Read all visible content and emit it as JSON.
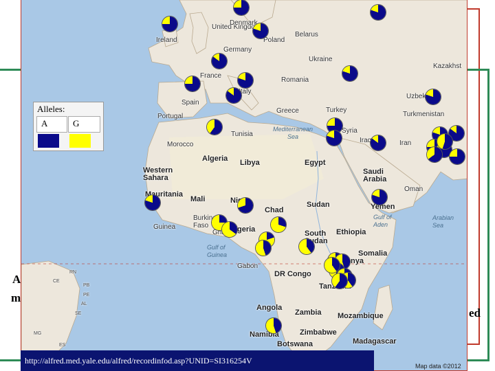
{
  "slide_fragments": {
    "left_line1": "A",
    "left_line2": "m",
    "right_word": "ed"
  },
  "legend": {
    "title": "Alleles:",
    "allele_a": "A",
    "allele_g": "G",
    "color_a": "#0a0a8a",
    "color_g": "#ffff00"
  },
  "url": "http://alfred.med.yale.edu/alfred/recordinfod.asp?UNID=SI316254V",
  "map_credit": "Map data ©2012",
  "countries": {
    "ireland": "Ireland",
    "united_kingdom": "United\nKingdom",
    "denmark": "Denmark",
    "germany": "Germany",
    "poland": "Poland",
    "belarus": "Belarus",
    "ukraine": "Ukraine",
    "kazakhstan": "Kazakhst",
    "france": "France",
    "romania": "Romania",
    "italy": "Italy",
    "uzbekistan": "Uzbekistan",
    "spain": "Spain",
    "portugal": "Portugal",
    "greece": "Greece",
    "turkey": "Turkey",
    "turkmenistan": "Turkmenistan",
    "syria": "Syria",
    "iraq": "Iraq",
    "iran": "Iran",
    "tunisia": "Tunisia",
    "morocco": "Morocco",
    "algeria": "Algeria",
    "libya": "Libya",
    "egypt": "Egypt",
    "saudi_arabia": "Saudi\nArabia",
    "oman": "Oman",
    "western_sahara": "Western\nSahara",
    "mauritania": "Mauritania",
    "mali": "Mali",
    "niger": "Niger",
    "chad": "Chad",
    "sudan": "Sudan",
    "yemen": "Yemen",
    "burkina_faso": "Burkina\nFaso",
    "ghana": "Ghana",
    "guinea": "Guinea",
    "nigeria": "Nigeria",
    "south_sudan": "South\nSudan",
    "ethiopia": "Ethiopia",
    "somalia": "Somalia",
    "gabon": "Gabon",
    "kenya": "Kenya",
    "dr_congo": "DR Congo",
    "tanzania": "Tanzania",
    "angola": "Angola",
    "zambia": "Zambia",
    "mozambique": "Mozambique",
    "namibia": "Namibia",
    "zimbabwe": "Zimbabwe",
    "botswana": "Botswana",
    "madagascar": "Madagascar"
  },
  "seas": {
    "mediterranean": "Mediterranean\nSea",
    "gulf_of_aden": "Gulf of\nAden",
    "arabian_sea": "Arabian\nSea",
    "gulf_of_guinea": "Gulf of\nGuinea"
  },
  "brazil_states": [
    "RN",
    "CE",
    "PB",
    "PE",
    "AL",
    "SE",
    "MG",
    "ES"
  ],
  "populations": [
    {
      "name": "pop-1",
      "a_fraction": 0.75
    },
    {
      "name": "pop-2",
      "a_fraction": 0.8
    },
    {
      "name": "pop-3",
      "a_fraction": 0.75
    },
    {
      "name": "pop-4",
      "a_fraction": 0.8
    },
    {
      "name": "pop-5",
      "a_fraction": 0.85
    },
    {
      "name": "pop-6",
      "a_fraction": 0.8
    },
    {
      "name": "pop-7",
      "a_fraction": 0.75
    },
    {
      "name": "pop-8",
      "a_fraction": 0.8
    },
    {
      "name": "pop-9",
      "a_fraction": 0.85
    },
    {
      "name": "pop-10",
      "a_fraction": 0.8
    },
    {
      "name": "pop-11",
      "a_fraction": 0.6
    },
    {
      "name": "pop-12",
      "a_fraction": 0.75
    },
    {
      "name": "pop-13",
      "a_fraction": 0.8
    },
    {
      "name": "pop-14",
      "a_fraction": 0.85
    },
    {
      "name": "pop-15",
      "a_fraction": 0.8
    },
    {
      "name": "pop-16",
      "a_fraction": 0.85
    },
    {
      "name": "pop-17",
      "a_fraction": 0.75
    },
    {
      "name": "pop-18",
      "a_fraction": 0.8
    },
    {
      "name": "pop-19",
      "a_fraction": 0.75
    },
    {
      "name": "pop-20",
      "a_fraction": 0.8
    },
    {
      "name": "pop-21",
      "a_fraction": 0.8
    },
    {
      "name": "pop-22",
      "a_fraction": 0.7
    },
    {
      "name": "pop-23",
      "a_fraction": 0.25
    },
    {
      "name": "pop-24",
      "a_fraction": 0.35
    },
    {
      "name": "pop-25",
      "a_fraction": 0.3
    },
    {
      "name": "pop-26",
      "a_fraction": 0.2
    },
    {
      "name": "pop-27",
      "a_fraction": 0.45
    },
    {
      "name": "pop-28",
      "a_fraction": 0.4
    },
    {
      "name": "pop-29",
      "a_fraction": 0.35
    },
    {
      "name": "pop-30",
      "a_fraction": 0.45
    },
    {
      "name": "pop-31",
      "a_fraction": 0.55
    },
    {
      "name": "pop-32",
      "a_fraction": 0.5
    },
    {
      "name": "pop-33",
      "a_fraction": 0.4
    },
    {
      "name": "pop-34",
      "a_fraction": 0.6
    },
    {
      "name": "pop-35",
      "a_fraction": 0.45
    },
    {
      "name": "pop-36",
      "a_fraction": 0.55
    },
    {
      "name": "pop-37",
      "a_fraction": 0.65
    },
    {
      "name": "pop-38",
      "a_fraction": 0.4
    }
  ]
}
